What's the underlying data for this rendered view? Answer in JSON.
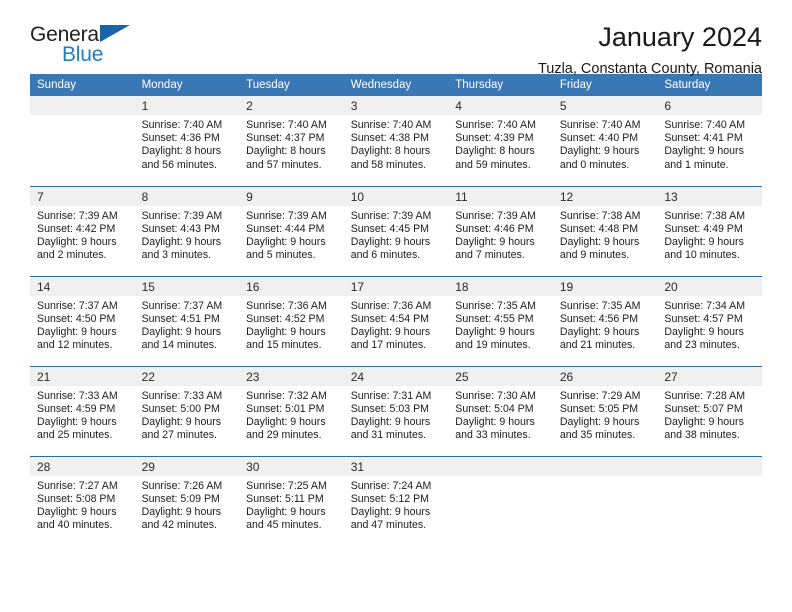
{
  "brand": {
    "name_part1": "General",
    "name_part2": "Blue",
    "accent_color": "#1f7fc4",
    "triangle_color": "#1565a8"
  },
  "header": {
    "title": "January 2024",
    "subtitle": "Tuzla, Constanta County, Romania",
    "header_bg": "#3a78b5",
    "row_divider": "#2e6da4",
    "daynum_bg": "#f0f0f0"
  },
  "weekday_headers": [
    "Sunday",
    "Monday",
    "Tuesday",
    "Wednesday",
    "Thursday",
    "Friday",
    "Saturday"
  ],
  "weeks": [
    [
      {
        "day": "",
        "sunrise": "",
        "sunset": "",
        "daylight1": "",
        "daylight2": "",
        "empty": true
      },
      {
        "day": "1",
        "sunrise": "Sunrise: 7:40 AM",
        "sunset": "Sunset: 4:36 PM",
        "daylight1": "Daylight: 8 hours",
        "daylight2": "and 56 minutes.",
        "empty": false
      },
      {
        "day": "2",
        "sunrise": "Sunrise: 7:40 AM",
        "sunset": "Sunset: 4:37 PM",
        "daylight1": "Daylight: 8 hours",
        "daylight2": "and 57 minutes.",
        "empty": false
      },
      {
        "day": "3",
        "sunrise": "Sunrise: 7:40 AM",
        "sunset": "Sunset: 4:38 PM",
        "daylight1": "Daylight: 8 hours",
        "daylight2": "and 58 minutes.",
        "empty": false
      },
      {
        "day": "4",
        "sunrise": "Sunrise: 7:40 AM",
        "sunset": "Sunset: 4:39 PM",
        "daylight1": "Daylight: 8 hours",
        "daylight2": "and 59 minutes.",
        "empty": false
      },
      {
        "day": "5",
        "sunrise": "Sunrise: 7:40 AM",
        "sunset": "Sunset: 4:40 PM",
        "daylight1": "Daylight: 9 hours",
        "daylight2": "and 0 minutes.",
        "empty": false
      },
      {
        "day": "6",
        "sunrise": "Sunrise: 7:40 AM",
        "sunset": "Sunset: 4:41 PM",
        "daylight1": "Daylight: 9 hours",
        "daylight2": "and 1 minute.",
        "empty": false
      }
    ],
    [
      {
        "day": "7",
        "sunrise": "Sunrise: 7:39 AM",
        "sunset": "Sunset: 4:42 PM",
        "daylight1": "Daylight: 9 hours",
        "daylight2": "and 2 minutes.",
        "empty": false
      },
      {
        "day": "8",
        "sunrise": "Sunrise: 7:39 AM",
        "sunset": "Sunset: 4:43 PM",
        "daylight1": "Daylight: 9 hours",
        "daylight2": "and 3 minutes.",
        "empty": false
      },
      {
        "day": "9",
        "sunrise": "Sunrise: 7:39 AM",
        "sunset": "Sunset: 4:44 PM",
        "daylight1": "Daylight: 9 hours",
        "daylight2": "and 5 minutes.",
        "empty": false
      },
      {
        "day": "10",
        "sunrise": "Sunrise: 7:39 AM",
        "sunset": "Sunset: 4:45 PM",
        "daylight1": "Daylight: 9 hours",
        "daylight2": "and 6 minutes.",
        "empty": false
      },
      {
        "day": "11",
        "sunrise": "Sunrise: 7:39 AM",
        "sunset": "Sunset: 4:46 PM",
        "daylight1": "Daylight: 9 hours",
        "daylight2": "and 7 minutes.",
        "empty": false
      },
      {
        "day": "12",
        "sunrise": "Sunrise: 7:38 AM",
        "sunset": "Sunset: 4:48 PM",
        "daylight1": "Daylight: 9 hours",
        "daylight2": "and 9 minutes.",
        "empty": false
      },
      {
        "day": "13",
        "sunrise": "Sunrise: 7:38 AM",
        "sunset": "Sunset: 4:49 PM",
        "daylight1": "Daylight: 9 hours",
        "daylight2": "and 10 minutes.",
        "empty": false
      }
    ],
    [
      {
        "day": "14",
        "sunrise": "Sunrise: 7:37 AM",
        "sunset": "Sunset: 4:50 PM",
        "daylight1": "Daylight: 9 hours",
        "daylight2": "and 12 minutes.",
        "empty": false
      },
      {
        "day": "15",
        "sunrise": "Sunrise: 7:37 AM",
        "sunset": "Sunset: 4:51 PM",
        "daylight1": "Daylight: 9 hours",
        "daylight2": "and 14 minutes.",
        "empty": false
      },
      {
        "day": "16",
        "sunrise": "Sunrise: 7:36 AM",
        "sunset": "Sunset: 4:52 PM",
        "daylight1": "Daylight: 9 hours",
        "daylight2": "and 15 minutes.",
        "empty": false
      },
      {
        "day": "17",
        "sunrise": "Sunrise: 7:36 AM",
        "sunset": "Sunset: 4:54 PM",
        "daylight1": "Daylight: 9 hours",
        "daylight2": "and 17 minutes.",
        "empty": false
      },
      {
        "day": "18",
        "sunrise": "Sunrise: 7:35 AM",
        "sunset": "Sunset: 4:55 PM",
        "daylight1": "Daylight: 9 hours",
        "daylight2": "and 19 minutes.",
        "empty": false
      },
      {
        "day": "19",
        "sunrise": "Sunrise: 7:35 AM",
        "sunset": "Sunset: 4:56 PM",
        "daylight1": "Daylight: 9 hours",
        "daylight2": "and 21 minutes.",
        "empty": false
      },
      {
        "day": "20",
        "sunrise": "Sunrise: 7:34 AM",
        "sunset": "Sunset: 4:57 PM",
        "daylight1": "Daylight: 9 hours",
        "daylight2": "and 23 minutes.",
        "empty": false
      }
    ],
    [
      {
        "day": "21",
        "sunrise": "Sunrise: 7:33 AM",
        "sunset": "Sunset: 4:59 PM",
        "daylight1": "Daylight: 9 hours",
        "daylight2": "and 25 minutes.",
        "empty": false
      },
      {
        "day": "22",
        "sunrise": "Sunrise: 7:33 AM",
        "sunset": "Sunset: 5:00 PM",
        "daylight1": "Daylight: 9 hours",
        "daylight2": "and 27 minutes.",
        "empty": false
      },
      {
        "day": "23",
        "sunrise": "Sunrise: 7:32 AM",
        "sunset": "Sunset: 5:01 PM",
        "daylight1": "Daylight: 9 hours",
        "daylight2": "and 29 minutes.",
        "empty": false
      },
      {
        "day": "24",
        "sunrise": "Sunrise: 7:31 AM",
        "sunset": "Sunset: 5:03 PM",
        "daylight1": "Daylight: 9 hours",
        "daylight2": "and 31 minutes.",
        "empty": false
      },
      {
        "day": "25",
        "sunrise": "Sunrise: 7:30 AM",
        "sunset": "Sunset: 5:04 PM",
        "daylight1": "Daylight: 9 hours",
        "daylight2": "and 33 minutes.",
        "empty": false
      },
      {
        "day": "26",
        "sunrise": "Sunrise: 7:29 AM",
        "sunset": "Sunset: 5:05 PM",
        "daylight1": "Daylight: 9 hours",
        "daylight2": "and 35 minutes.",
        "empty": false
      },
      {
        "day": "27",
        "sunrise": "Sunrise: 7:28 AM",
        "sunset": "Sunset: 5:07 PM",
        "daylight1": "Daylight: 9 hours",
        "daylight2": "and 38 minutes.",
        "empty": false
      }
    ],
    [
      {
        "day": "28",
        "sunrise": "Sunrise: 7:27 AM",
        "sunset": "Sunset: 5:08 PM",
        "daylight1": "Daylight: 9 hours",
        "daylight2": "and 40 minutes.",
        "empty": false
      },
      {
        "day": "29",
        "sunrise": "Sunrise: 7:26 AM",
        "sunset": "Sunset: 5:09 PM",
        "daylight1": "Daylight: 9 hours",
        "daylight2": "and 42 minutes.",
        "empty": false
      },
      {
        "day": "30",
        "sunrise": "Sunrise: 7:25 AM",
        "sunset": "Sunset: 5:11 PM",
        "daylight1": "Daylight: 9 hours",
        "daylight2": "and 45 minutes.",
        "empty": false
      },
      {
        "day": "31",
        "sunrise": "Sunrise: 7:24 AM",
        "sunset": "Sunset: 5:12 PM",
        "daylight1": "Daylight: 9 hours",
        "daylight2": "and 47 minutes.",
        "empty": false
      },
      {
        "day": "",
        "sunrise": "",
        "sunset": "",
        "daylight1": "",
        "daylight2": "",
        "empty": true
      },
      {
        "day": "",
        "sunrise": "",
        "sunset": "",
        "daylight1": "",
        "daylight2": "",
        "empty": true
      },
      {
        "day": "",
        "sunrise": "",
        "sunset": "",
        "daylight1": "",
        "daylight2": "",
        "empty": true
      }
    ]
  ]
}
